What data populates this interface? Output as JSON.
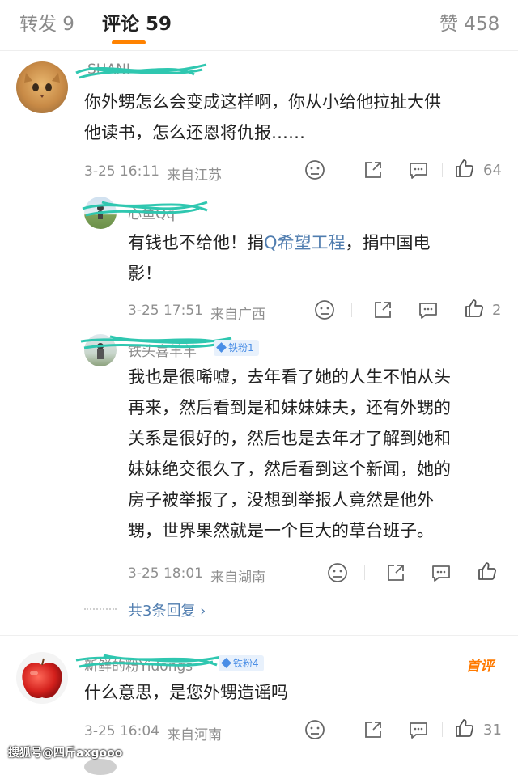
{
  "tabs": {
    "repost": "转发 9",
    "comment": "评论 59",
    "like": "赞 458"
  },
  "comments": [
    {
      "user": "SHANI",
      "text_lines": [
        "你外甥怎么会变成这样啊，你从小给他拉扯大供",
        "他读书，怎么还恩将仇报……"
      ],
      "time": "3-25 16:11",
      "location": "来自江苏",
      "likes": "64"
    },
    {
      "user": "心鱼Qq",
      "text_pre": "有钱也不给他！捐",
      "topic": "Q希望工程",
      "text_post": "，捐中国电",
      "text_line2": "影！",
      "time": "3-25 17:51",
      "location": "来自广西",
      "likes": "2"
    },
    {
      "user": "铁头喜羊羊",
      "badge": "铁粉1",
      "text_lines": [
        "我也是很唏嘘，去年看了她的人生不怕从头",
        "再来，然后看到是和妹妹妹夫，还有外甥的",
        "关系是很好的，然后也是去年才了解到她和",
        "妹妹绝交很久了，然后看到这个新闻，她的",
        "房子被举报了，没想到举报人竟然是他外",
        "甥，世界果然就是一个巨大的草台班子。"
      ],
      "time": "3-25 18:01",
      "location": "来自湖南",
      "replies_link": "共3条回复 ›"
    },
    {
      "user": "新鲜的粉Yidongs",
      "badge": "铁粉4",
      "first_tag": "首评",
      "text_lines": [
        "什么意思，是您外甥造谣吗"
      ],
      "time": "3-25 16:04",
      "location": "来自河南",
      "likes": "31"
    }
  ],
  "watermark": "搜狐号@四斤axgooo",
  "colors": {
    "accent": "#ff8200",
    "link": "#507daf",
    "scribble": "#2fc7b0"
  },
  "icons": [
    "dislike-icon",
    "share-icon",
    "comment-icon",
    "like-icon",
    "chevron-right-icon"
  ]
}
